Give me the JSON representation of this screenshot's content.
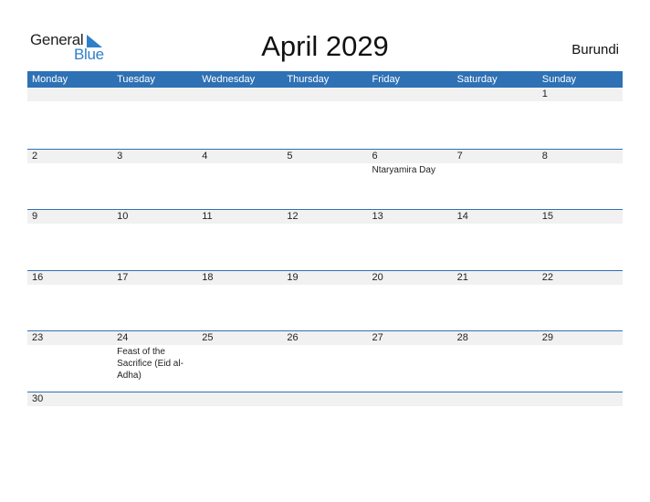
{
  "brand": {
    "line1": "General",
    "line2": "Blue",
    "icon": "triangle-flag-icon",
    "accent": "#2f7fc8"
  },
  "title": "April 2029",
  "country": "Burundi",
  "colors": {
    "header_bg": "#2e71b5",
    "band_bg": "#f1f1f1"
  },
  "weekdays": [
    "Monday",
    "Tuesday",
    "Wednesday",
    "Thursday",
    "Friday",
    "Saturday",
    "Sunday"
  ],
  "weeks": [
    {
      "days": [
        {
          "num": "",
          "event": ""
        },
        {
          "num": "",
          "event": ""
        },
        {
          "num": "",
          "event": ""
        },
        {
          "num": "",
          "event": ""
        },
        {
          "num": "",
          "event": ""
        },
        {
          "num": "",
          "event": ""
        },
        {
          "num": "1",
          "event": ""
        }
      ]
    },
    {
      "days": [
        {
          "num": "2",
          "event": ""
        },
        {
          "num": "3",
          "event": ""
        },
        {
          "num": "4",
          "event": ""
        },
        {
          "num": "5",
          "event": ""
        },
        {
          "num": "6",
          "event": "Ntaryamira Day"
        },
        {
          "num": "7",
          "event": ""
        },
        {
          "num": "8",
          "event": ""
        }
      ]
    },
    {
      "days": [
        {
          "num": "9",
          "event": ""
        },
        {
          "num": "10",
          "event": ""
        },
        {
          "num": "11",
          "event": ""
        },
        {
          "num": "12",
          "event": ""
        },
        {
          "num": "13",
          "event": ""
        },
        {
          "num": "14",
          "event": ""
        },
        {
          "num": "15",
          "event": ""
        }
      ]
    },
    {
      "days": [
        {
          "num": "16",
          "event": ""
        },
        {
          "num": "17",
          "event": ""
        },
        {
          "num": "18",
          "event": ""
        },
        {
          "num": "19",
          "event": ""
        },
        {
          "num": "20",
          "event": ""
        },
        {
          "num": "21",
          "event": ""
        },
        {
          "num": "22",
          "event": ""
        }
      ]
    },
    {
      "days": [
        {
          "num": "23",
          "event": ""
        },
        {
          "num": "24",
          "event": "Feast of the Sacrifice (Eid al-Adha)"
        },
        {
          "num": "25",
          "event": ""
        },
        {
          "num": "26",
          "event": ""
        },
        {
          "num": "27",
          "event": ""
        },
        {
          "num": "28",
          "event": ""
        },
        {
          "num": "29",
          "event": ""
        }
      ]
    },
    {
      "days": [
        {
          "num": "30",
          "event": ""
        },
        {
          "num": "",
          "event": ""
        },
        {
          "num": "",
          "event": ""
        },
        {
          "num": "",
          "event": ""
        },
        {
          "num": "",
          "event": ""
        },
        {
          "num": "",
          "event": ""
        },
        {
          "num": "",
          "event": ""
        }
      ]
    }
  ]
}
